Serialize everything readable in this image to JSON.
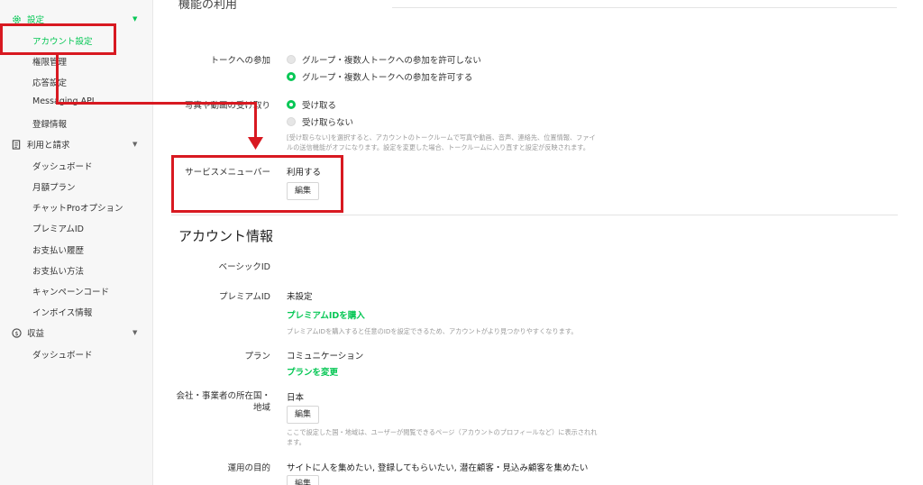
{
  "sidebar": {
    "sections": [
      {
        "label": "設定",
        "icon": "gear-icon"
      },
      {
        "label": "利用と請求",
        "icon": "document-icon"
      },
      {
        "label": "収益",
        "icon": "dollar-coin-icon"
      }
    ],
    "settings_items": [
      "アカウント設定",
      "権限管理",
      "応答設定",
      "Messaging API",
      "登録情報"
    ],
    "billing_items": [
      "ダッシュボード",
      "月額プラン",
      "チャットProオプション",
      "プレミアムID",
      "お支払い履歴",
      "お支払い方法",
      "キャンペーンコード",
      "インボイス情報"
    ],
    "revenue_items": [
      "ダッシュボード"
    ]
  },
  "features": {
    "cut_title": "機能の利用",
    "talk": {
      "label": "トークへの参加",
      "option_disallow": "グループ・複数人トークへの参加を許可しない",
      "option_allow": "グループ・複数人トークへの参加を許可する",
      "selected": "allow"
    },
    "media": {
      "label": "写真や動画の受け取り",
      "option_receive": "受け取る",
      "option_not_receive": "受け取らない",
      "selected": "receive",
      "note_line1": "[受け取らない]を選択すると、アカウントのトークルームで写真や動画、音声、連絡先、位置情報、ファイ",
      "note_line2": "ルの送信機能がオフになります。設定を変更した場合、トークルームに入り直すと設定が反映されます。"
    },
    "service_menu": {
      "label": "サービスメニューバー",
      "value": "利用する",
      "edit": "編集"
    }
  },
  "account": {
    "title": "アカウント情報",
    "basic_id_label": "ベーシックID",
    "premium_id_label": "プレミアムID",
    "premium_id_value": "未設定",
    "premium_id_link": "プレミアムIDを購入",
    "premium_id_note": "プレミアムIDを購入すると任意のIDを設定できるため、アカウントがより見つかりやすくなります。",
    "plan_label": "プラン",
    "plan_value": "コミュニケーション",
    "plan_link": "プランを変更",
    "country_label_line1": "会社・事業者の所在国・",
    "country_label_line2": "地域",
    "country_value": "日本",
    "country_edit": "編集",
    "country_note_line1": "ここで設定した国・地域は、ユーザーが閲覧できるページ（アカウントのプロフィールなど）に表示されれ",
    "country_note_line2": "ます。",
    "purpose_label": "運用の目的",
    "purpose_value": "サイトに人を集めたい, 登録してもらいたい, 潜在顧客・見込み顧客を集めたい",
    "purpose_edit": "編集"
  },
  "colors": {
    "accent": "#06c755",
    "annotation": "#d81921"
  }
}
